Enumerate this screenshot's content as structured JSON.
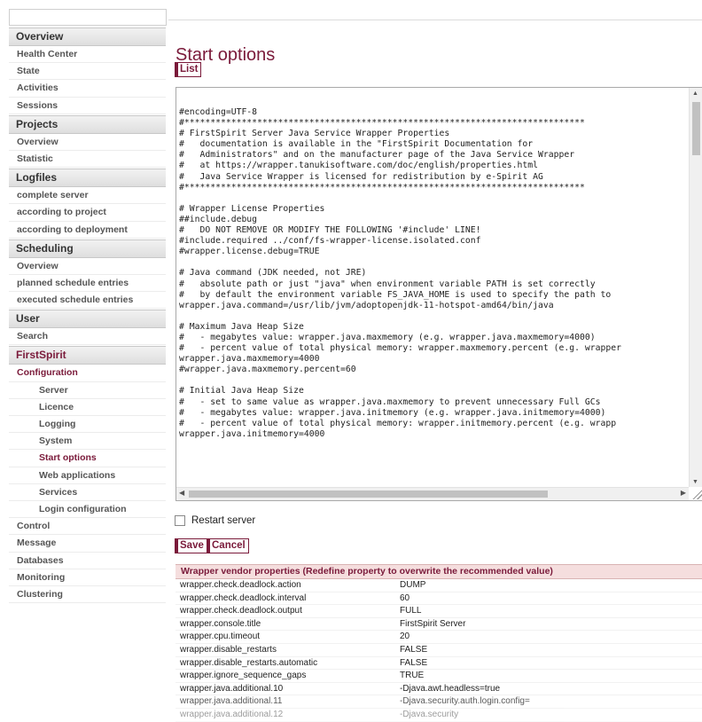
{
  "sidebar": {
    "sections": [
      {
        "title": "Overview",
        "items": [
          "Health Center",
          "State",
          "Activities",
          "Sessions"
        ]
      },
      {
        "title": "Projects",
        "items": [
          "Overview",
          "Statistic"
        ]
      },
      {
        "title": "Logfiles",
        "items": [
          "complete server",
          "according to project",
          "according to deployment"
        ]
      },
      {
        "title": "Scheduling",
        "items": [
          "Overview",
          "planned schedule entries",
          "executed schedule entries"
        ]
      },
      {
        "title": "User",
        "items": [
          "Search"
        ]
      },
      {
        "title": "FirstSpirit",
        "items": [
          "Configuration",
          "Server",
          "Licence",
          "Logging",
          "System",
          "Start options",
          "Web applications",
          "Services",
          "Login configuration",
          "Control",
          "Message",
          "Databases",
          "Monitoring",
          "Clustering"
        ]
      }
    ]
  },
  "main": {
    "title": "Start options",
    "list_button": "List",
    "editor_text": "#encoding=UTF-8\n#*****************************************************************************\n# FirstSpirit Server Java Service Wrapper Properties\n#   documentation is available in the \"FirstSpirit Documentation for\n#   Administrators\" and on the manufacturer page of the Java Service Wrapper\n#   at https://wrapper.tanukisoftware.com/doc/english/properties.html\n#   Java Service Wrapper is licensed for redistribution by e-Spirit AG\n#*****************************************************************************\n\n# Wrapper License Properties\n##include.debug\n#   DO NOT REMOVE OR MODIFY THE FOLLOWING '#include' LINE!\n#include.required ../conf/fs-wrapper-license.isolated.conf\n#wrapper.license.debug=TRUE\n\n# Java command (JDK needed, not JRE)\n#   absolute path or just \"java\" when environment variable PATH is set correctly\n#   by default the environment variable FS_JAVA_HOME is used to specify the path to\nwrapper.java.command=/usr/lib/jvm/adoptopenjdk-11-hotspot-amd64/bin/java\n\n# Maximum Java Heap Size\n#   - megabytes value: wrapper.java.maxmemory (e.g. wrapper.java.maxmemory=4000)\n#   - percent value of total physical memory: wrapper.maxmemory.percent (e.g. wrapper\nwrapper.java.maxmemory=4000\n#wrapper.java.maxmemory.percent=60\n\n# Initial Java Heap Size\n#   - set to same value as wrapper.java.maxmemory to prevent unnecessary Full GCs\n#   - megabytes value: wrapper.java.initmemory (e.g. wrapper.java.initmemory=4000)\n#   - percent value of total physical memory: wrapper.initmemory.percent (e.g. wrapp\nwrapper.java.initmemory=4000",
    "restart_label": "Restart server",
    "save_button": "Save",
    "cancel_button": "Cancel"
  },
  "vendor_table": {
    "header": "Wrapper vendor properties (Redefine property to overwrite the recommended value)",
    "rows": [
      {
        "key": "wrapper.check.deadlock.action",
        "value": "DUMP"
      },
      {
        "key": "wrapper.check.deadlock.interval",
        "value": "60"
      },
      {
        "key": "wrapper.check.deadlock.output",
        "value": "FULL"
      },
      {
        "key": "wrapper.console.title",
        "value": "FirstSpirit Server"
      },
      {
        "key": "wrapper.cpu.timeout",
        "value": "20"
      },
      {
        "key": "wrapper.disable_restarts",
        "value": "FALSE"
      },
      {
        "key": "wrapper.disable_restarts.automatic",
        "value": "FALSE"
      },
      {
        "key": "wrapper.ignore_sequence_gaps",
        "value": "TRUE"
      },
      {
        "key": "wrapper.java.additional.10",
        "value": "-Djava.awt.headless=true"
      },
      {
        "key": "wrapper.java.additional.11",
        "value": "-Djava.security.auth.login.config="
      },
      {
        "key": "wrapper.java.additional.12",
        "value": "-Djava.security"
      }
    ]
  },
  "colors": {
    "accent": "#7a1a3a",
    "table_header_bg": "#f5dede"
  }
}
